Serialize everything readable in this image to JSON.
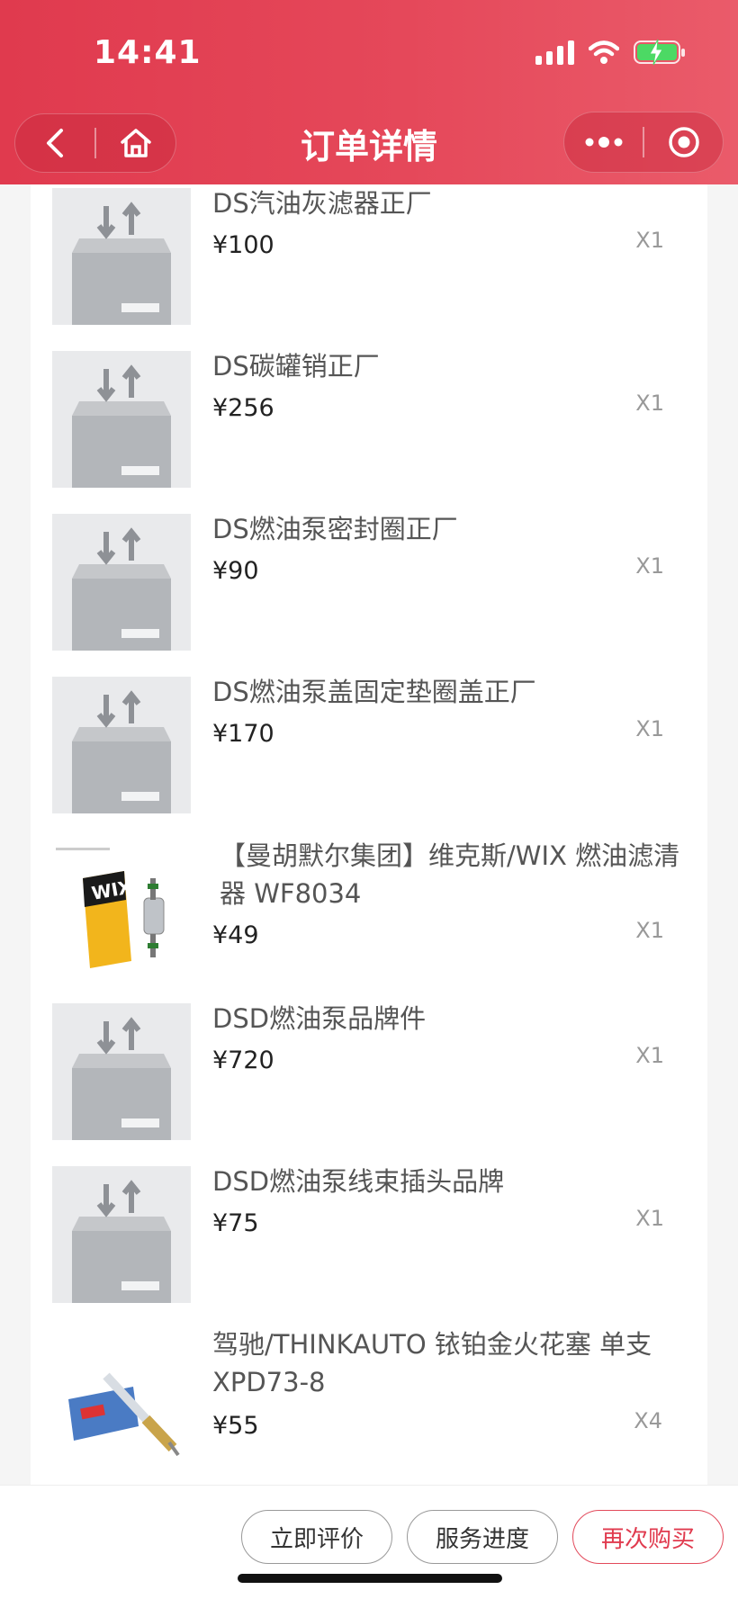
{
  "status_bar": {
    "time": "14:41"
  },
  "nav": {
    "title": "订单详情"
  },
  "items": [
    {
      "name": "DS汽油灰滤器正厂",
      "price": "¥100",
      "qty": "X1",
      "image": "placeholder-box-icon"
    },
    {
      "name": "DS碳罐销正厂",
      "price": "¥256",
      "qty": "X1",
      "image": "placeholder-box-icon"
    },
    {
      "name": "DS燃油泵密封圈正厂",
      "price": "¥90",
      "qty": "X1",
      "image": "placeholder-box-icon"
    },
    {
      "name": "DS燃油泵盖固定垫圈盖正厂",
      "price": "¥170",
      "qty": "X1",
      "image": "placeholder-box-icon"
    },
    {
      "name": "【曼胡默尔集团】维克斯/WIX 燃油滤清器 WF8034",
      "price": "¥49",
      "qty": "X1",
      "image": "wix-filter-product-photo",
      "brand_mark": "WIX"
    },
    {
      "name": "DSD燃油泵品牌件",
      "price": "¥720",
      "qty": "X1",
      "image": "placeholder-box-icon"
    },
    {
      "name": "DSD燃油泵线束插头品牌",
      "price": "¥75",
      "qty": "X1",
      "image": "placeholder-box-icon"
    },
    {
      "name": "驾驰/THINKAUTO 铱铂金火花塞 单支 XPD73-8",
      "price": "¥55",
      "qty": "X4",
      "image": "spark-plug-product-photo"
    }
  ],
  "actions": {
    "review": "立即评价",
    "progress": "服务进度",
    "rebuy": "再次购买"
  },
  "colors": {
    "brand": "#e03a4e",
    "background": "#f5f5f5"
  }
}
